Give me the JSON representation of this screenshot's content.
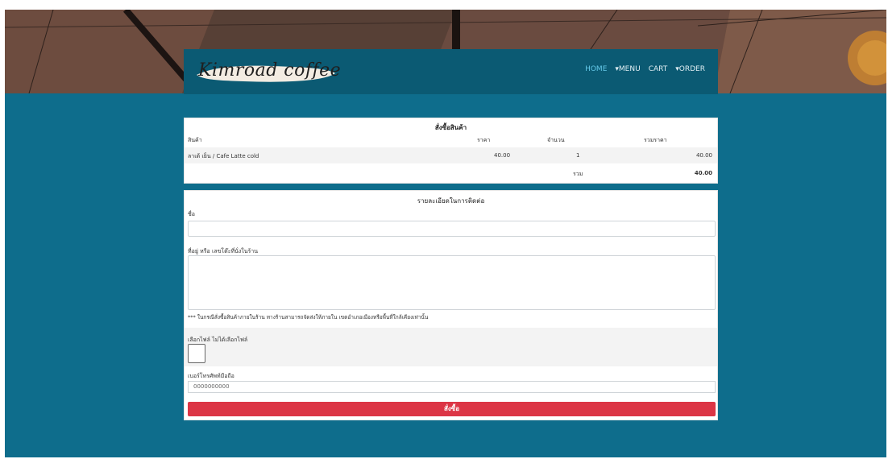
{
  "brand": {
    "logo_text": "Kimroad coffee"
  },
  "nav": {
    "items": [
      {
        "label": "HOME",
        "active": true
      },
      {
        "label": "MENU",
        "prefix": "▾"
      },
      {
        "label": "CART"
      },
      {
        "label": "ORDER",
        "prefix": "▾"
      }
    ]
  },
  "order": {
    "title": "สั่งซื้อสินค้า",
    "headers": {
      "product": "สินค้า",
      "price": "ราคา",
      "qty": "จำนวน",
      "total": "รวมราคา"
    },
    "items": [
      {
        "product": "ลาเต้ เย็น / Cafe Latte cold",
        "price": "40.00",
        "qty": "1",
        "total": "40.00"
      }
    ],
    "sum_label": "รวม",
    "sum_value": "40.00"
  },
  "contact": {
    "title": "รายละเอียดในการติดต่อ",
    "name_label": "ชื่อ",
    "name_value": "",
    "address_label": "ที่อยู่ หรือ เลขโต๊ะที่นั่งในร้าน",
    "address_value": "",
    "note": "*** ในกรณีสั่งซื้อสินค้าภายในร้าน ทางร้านสามารถจัดส่งให้ภายใน เขตอำเภอเมืองหรือพื้นที่ใกล้เคียงเท่านั้น",
    "file_label": "เลือกไฟล์ ไม่ได้เลือกไฟล์",
    "phone_label": "เบอร์โทรศัพท์มือถือ",
    "phone_placeholder": "0000000000",
    "submit_label": "สั่งซื้อ"
  },
  "colors": {
    "page_bg": "#0e6d8c",
    "navbar_bg": "#0b5a73",
    "nav_active": "#64c8e8",
    "submit_bg": "#dc3545"
  }
}
